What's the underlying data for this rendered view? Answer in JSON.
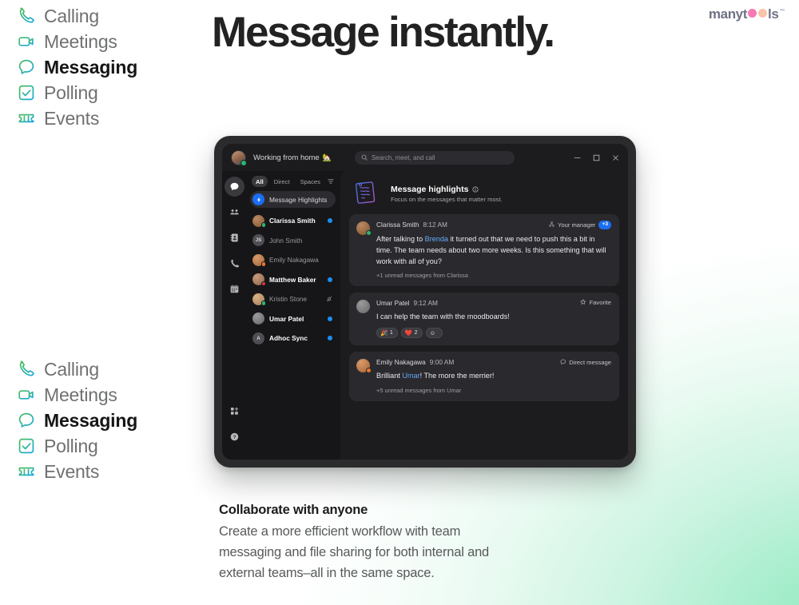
{
  "headline": "Message instantly.",
  "logo": {
    "pre": "many",
    "mid": "t",
    "post": "ls",
    "tm": "™"
  },
  "features": [
    {
      "icon": "phone-handset-icon",
      "label": "Calling",
      "active": false
    },
    {
      "icon": "video-camera-icon",
      "label": "Meetings",
      "active": false
    },
    {
      "icon": "chat-bubble-icon",
      "label": "Messaging",
      "active": true
    },
    {
      "icon": "checkbox-icon",
      "label": "Polling",
      "active": false
    },
    {
      "icon": "ticket-icon",
      "label": "Events",
      "active": false
    }
  ],
  "app": {
    "titlebar": {
      "status_text": "Working from home",
      "status_emoji": "🏡",
      "search_placeholder": "Search, meet, and call",
      "minimize": "−",
      "maximize": "□",
      "close": "✕"
    },
    "rail": [
      {
        "icon": "messaging-icon",
        "active": true
      },
      {
        "icon": "teams-icon",
        "active": false
      },
      {
        "icon": "contacts-book-icon",
        "active": false
      },
      {
        "icon": "phone-icon",
        "active": false
      },
      {
        "icon": "calendar-icon",
        "active": false
      }
    ],
    "rail_bottom": [
      {
        "icon": "apps-grid-icon"
      },
      {
        "icon": "help-icon"
      }
    ],
    "tabs": [
      {
        "label": "All",
        "active": true
      },
      {
        "label": "Direct",
        "active": false
      },
      {
        "label": "Spaces",
        "active": false
      }
    ],
    "filter_icon": "filter-icon",
    "highlight_row": {
      "label": "Message Highlights",
      "icon": "lightning-bolt-icon"
    },
    "contacts": [
      {
        "name": "Clarissa Smith",
        "unread": true,
        "presence": "online",
        "avatar_type": "photo",
        "avatar_color": "#b98a63",
        "initials": "",
        "right": "dot"
      },
      {
        "name": "John Smith",
        "unread": false,
        "presence": "",
        "avatar_type": "initials",
        "avatar_color": "#4e4e54",
        "initials": "JS",
        "right": ""
      },
      {
        "name": "Emily Nakagawa",
        "unread": false,
        "presence": "away",
        "avatar_type": "photo",
        "avatar_color": "#d89a6a",
        "initials": "",
        "right": ""
      },
      {
        "name": "Matthew Baker",
        "unread": true,
        "presence": "dnd",
        "avatar_type": "photo",
        "avatar_color": "#c59a7c",
        "initials": "",
        "right": "dot"
      },
      {
        "name": "Kristin Stone",
        "unread": false,
        "presence": "online",
        "avatar_type": "photo",
        "avatar_color": "#d9b189",
        "initials": "",
        "right": "mute"
      },
      {
        "name": "Umar Patel",
        "unread": true,
        "presence": "",
        "avatar_type": "photo",
        "avatar_color": "#9b9b9b",
        "initials": "",
        "right": "dot"
      },
      {
        "name": "Adhoc Sync",
        "unread": true,
        "presence": "",
        "avatar_type": "initials",
        "avatar_color": "#4e4e54",
        "initials": "A",
        "right": "dot"
      }
    ],
    "highlights_header": {
      "title": "Message highlights",
      "subtitle": "Focus on the messages that matter most.",
      "info_icon": "info-icon",
      "art_icon": "notes-artwork-icon"
    },
    "messages": [
      {
        "author": "Clarissa Smith",
        "time": "8:12 AM",
        "tag": "Your manager",
        "tag_icon": "org-hierarchy-icon",
        "pill": "+3",
        "body_pre": "After talking to ",
        "mention": "Brenda",
        "body_post": " it turned out that we need to push this a bit in time. The team needs about two more weeks. Is this something that will work with all of you?",
        "footer": "+1 unread messages from Clarissa",
        "avatar_color": "#b98a63",
        "presence": "online",
        "reactions": []
      },
      {
        "author": "Umar Patel",
        "time": "9:12 AM",
        "tag": "Favorite",
        "tag_icon": "star-icon",
        "pill": "",
        "body_pre": "I can help the team with the moodboards!",
        "mention": "",
        "body_post": "",
        "footer": "",
        "avatar_color": "#9b9b9b",
        "presence": "",
        "reactions": [
          {
            "emoji": "🎉",
            "count": "1"
          },
          {
            "emoji": "❤️",
            "count": "2"
          },
          {
            "emoji": "☺",
            "count": ""
          }
        ]
      },
      {
        "author": "Emily Nakagawa",
        "time": "9:00 AM",
        "tag": "Direct message",
        "tag_icon": "chat-bubble-outline-icon",
        "pill": "",
        "body_pre": "Brilliant ",
        "mention": "Umar",
        "body_post": "! The more the merrier!",
        "footer": "+5 unread messages from Umar",
        "avatar_color": "#d89a6a",
        "presence": "away",
        "reactions": []
      }
    ]
  },
  "caption": {
    "title": "Collaborate with anyone",
    "body": "Create a more efficient workflow with team messaging and file sharing for both internal and external teams–all in the same space."
  },
  "colors": {
    "accent_blue": "#1b6ef3",
    "mention_blue": "#63a9f7",
    "icon_gradient_start": "#4ebe5a",
    "icon_gradient_end": "#16a9dd",
    "mint": "#8fe8c0",
    "logo_pink": "#f77ab4",
    "logo_peach": "#f9c4a8"
  }
}
